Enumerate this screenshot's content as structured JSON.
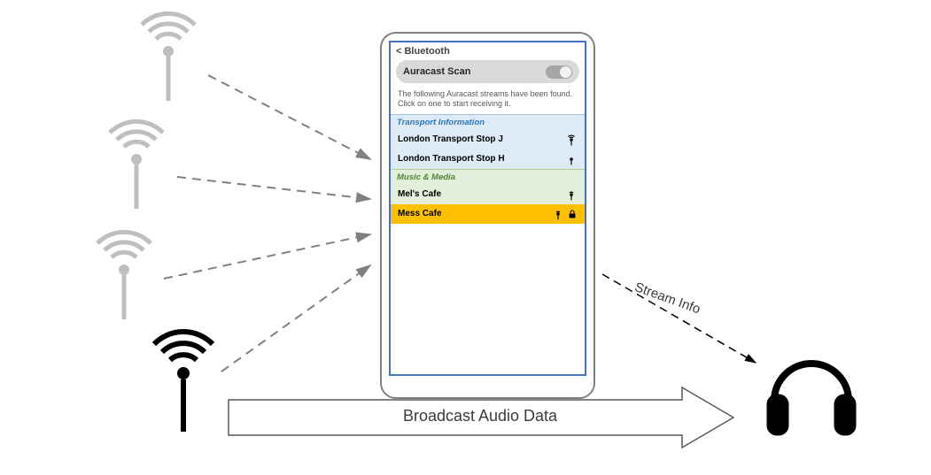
{
  "phone": {
    "back_label": "< Bluetooth",
    "scan_label": "Auracast Scan",
    "description": "The following Auracast streams have been found.  Click on one to start receiving it."
  },
  "categories": [
    {
      "title": "Transport Information",
      "theme": "blue",
      "items": [
        {
          "name": "London Transport Stop J",
          "locked": false,
          "selected": false
        },
        {
          "name": "London Transport Stop H",
          "locked": false,
          "selected": false
        }
      ]
    },
    {
      "title": "Music & Media",
      "theme": "green",
      "items": [
        {
          "name": "Mel's Cafe",
          "locked": false,
          "selected": false
        },
        {
          "name": "Mess Cafe",
          "locked": true,
          "selected": true
        }
      ]
    }
  ],
  "labels": {
    "broadcast": "Broadcast Audio Data",
    "stream": "Stream Info"
  },
  "colors": {
    "phone_border": "#808080",
    "screen_border": "#4472c4",
    "cat_blue_bg": "#deebf7",
    "cat_blue_fg": "#2e75b6",
    "cat_green_bg": "#e2efda",
    "cat_green_fg": "#548235",
    "selected_bg": "#ffc000"
  }
}
